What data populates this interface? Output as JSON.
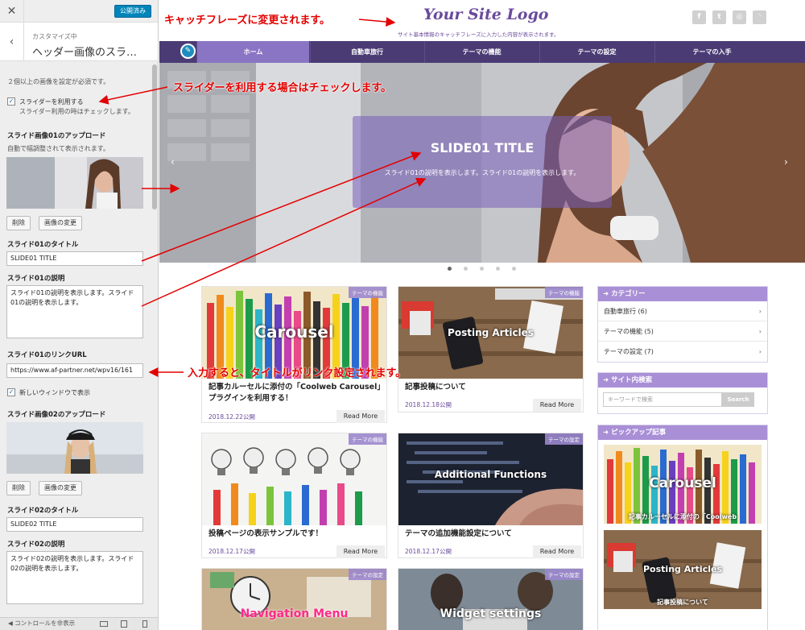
{
  "panel": {
    "close_icon": "close-icon",
    "publish": "公開済み",
    "breadcrumb": "カスタマイズ中",
    "title": "ヘッダー画像のスラ…",
    "note": "２個以上の画像を設定が必須です。",
    "use_slider_label": "スライダーを利用する",
    "use_slider_desc": "スライダー利用の時はチェックします。",
    "slide1_upload_label": "スライド画像01のアップロード",
    "slide1_upload_desc": "自動で幅調整されて表示されます。",
    "delete_btn": "削除",
    "change_btn": "画像の変更",
    "slide1_title_label": "スライド01のタイトル",
    "slide1_title_value": "SLIDE01 TITLE",
    "slide1_desc_label": "スライド01の説明",
    "slide1_desc_value": "スライド01の説明を表示します。スライド01の説明を表示します。",
    "slide1_url_label": "スライド01のリンクURL",
    "slide1_url_value": "https://www.af-partner.net/wpv16/161",
    "new_window_label": "新しいウィンドウで表示",
    "slide2_upload_label": "スライド画像02のアップロード",
    "slide2_title_label": "スライド02のタイトル",
    "slide2_title_value": "SLIDE02 TITLE",
    "slide2_desc_label": "スライド02の説明",
    "slide2_desc_value": "スライド02の説明を表示します。スライド02の説明を表示します。",
    "footer": "コントロールを非表示"
  },
  "site": {
    "logo": "Your Site Logo",
    "tagline": "サイト基本情報のキャッチフレーズに入力した内容が表示されます。",
    "social_icons": [
      "facebook-icon",
      "twitter-icon",
      "instagram-icon",
      "rss-icon"
    ],
    "nav": [
      "ホーム",
      "自動車旅行",
      "テーマの機能",
      "テーマの設定",
      "テーマの入手"
    ],
    "slide": {
      "title": "SLIDE01 TITLE",
      "desc": "スライド01の説明を表示します。スライド01の説明を表示します。"
    },
    "posts": [
      {
        "category": "テーマの機能",
        "image_text": "Carousel",
        "title": "記事カルーセルに添付の「Coolweb Carousel」プラグインを利用する！",
        "date": "2018.12.22公開",
        "more": "Read More"
      },
      {
        "category": "テーマの機能",
        "image_text": "Posting Articles",
        "title": "記事投稿について",
        "date": "2018.12.18公開",
        "more": "Read More"
      },
      {
        "category": "テーマの機能",
        "image_text": "",
        "title": "投稿ページの表示サンプルです！",
        "date": "2018.12.17公開",
        "more": "Read More"
      },
      {
        "category": "テーマの設定",
        "image_text": "Additional Functions",
        "title": "テーマの追加機能設定について",
        "date": "2018.12.17公開",
        "more": "Read More"
      },
      {
        "category": "テーマの設定",
        "image_text": "Navigation Menu"
      },
      {
        "category": "テーマの設定",
        "image_text": "Widget settings"
      }
    ],
    "sidebar": {
      "categories_title": "カテゴリー",
      "categories": [
        "自動車旅行 (6)",
        "テーマの機能 (5)",
        "テーマの設定 (7)"
      ],
      "search_title": "サイト内検索",
      "search_placeholder": "キーワードで検索",
      "search_btn": "Search",
      "pickup_title": "ピックアップ記事",
      "pickup_1_image_text": "Carousel",
      "pickup_1_caption": "記事カルーセルに添付の「Coolweb",
      "pickup_2_image_text": "Posting Articles",
      "pickup_2_caption": "記事投稿について"
    }
  },
  "annotations": {
    "catchphrase": "キャッチフレーズに変更されます。",
    "slider_check": "スライダーを利用する場合はチェックします。",
    "link": "入力すると、タイトルがリンク設定されます。"
  },
  "colors": {
    "brand": "#4b3b74",
    "accent": "#a98fd6",
    "annotation": "#e30000"
  }
}
